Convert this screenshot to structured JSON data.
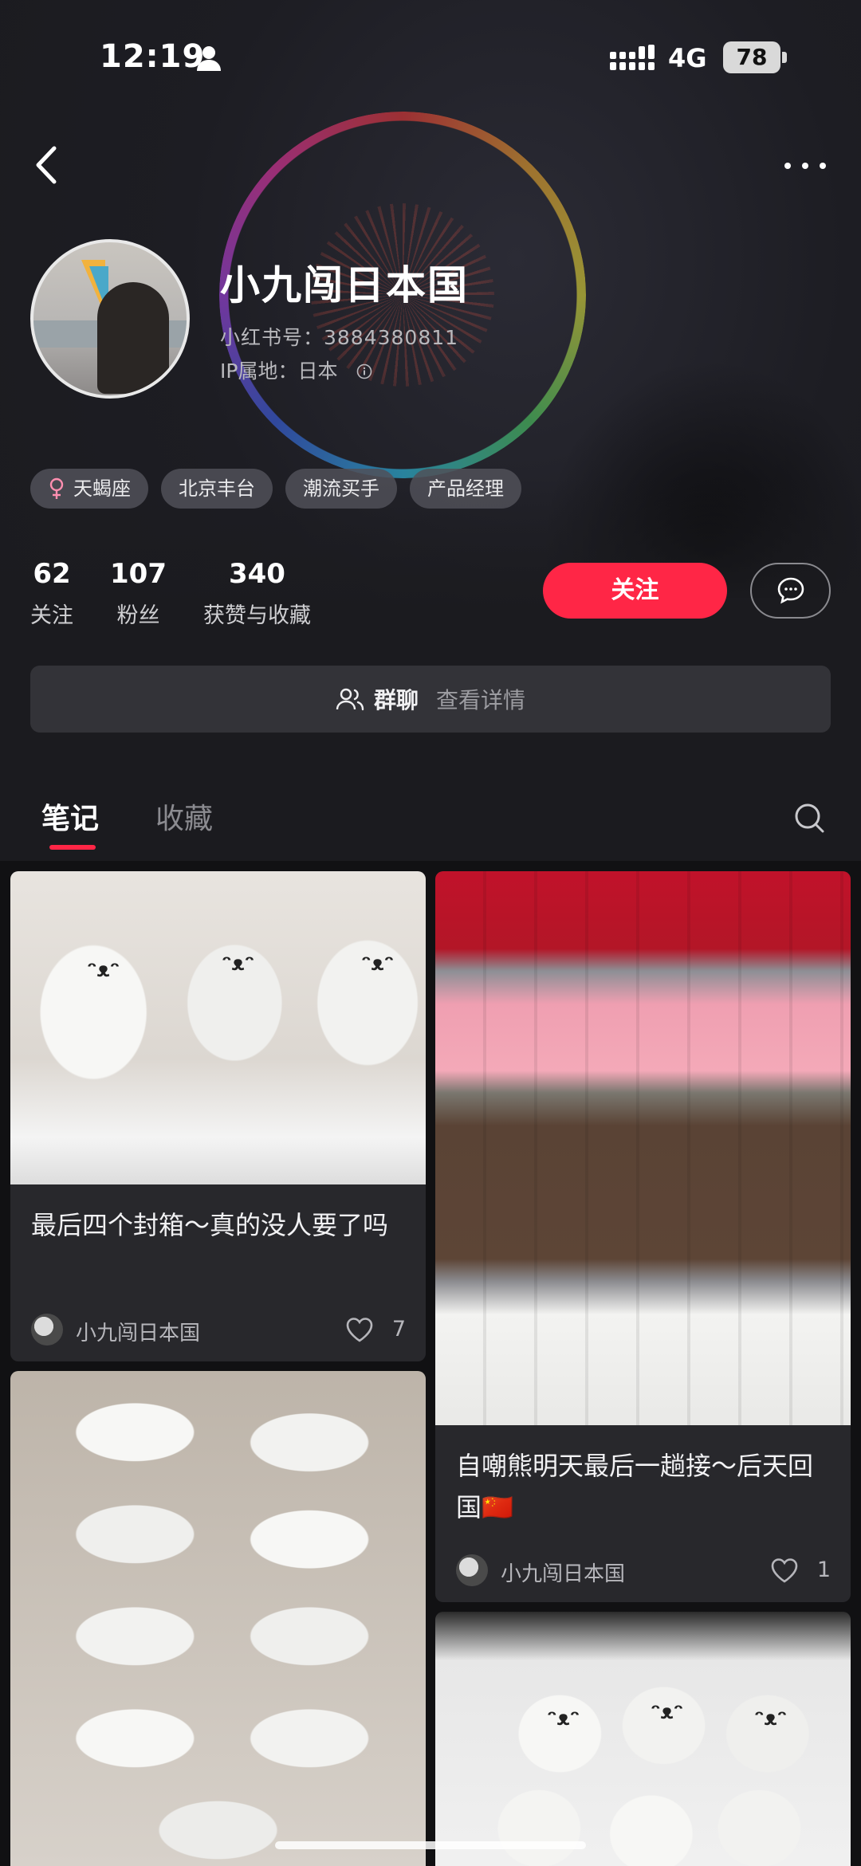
{
  "status_bar": {
    "time": "12:19",
    "network": "4G",
    "battery": "78"
  },
  "profile": {
    "name": "小九闯日本国",
    "account_id": "小红书号：3884380811",
    "ip_location": "IP属地：日本",
    "tags": [
      "天蝎座",
      "北京丰台",
      "潮流买手",
      "产品经理"
    ],
    "stats": [
      {
        "num": "62",
        "label": "关注"
      },
      {
        "num": "107",
        "label": "粉丝"
      },
      {
        "num": "340",
        "label": "获赞与收藏"
      }
    ],
    "follow_label": "关注",
    "group_chat_label": "群聊",
    "group_chat_detail": "查看详情"
  },
  "tabs": [
    {
      "label": "笔记",
      "active": true
    },
    {
      "label": "收藏",
      "active": false
    }
  ],
  "notes": [
    {
      "title": "最后四个封箱～真的没人要了吗",
      "author": "小九闯日本国",
      "likes": "7"
    },
    {
      "title": "自嘲熊明天最后一趟接～后天回国🇨🇳",
      "author": "小九闯日本国",
      "likes": "1"
    }
  ],
  "colors": {
    "accent": "#ff2646",
    "background": "#1b1b1f",
    "card": "#28282c"
  },
  "icons": [
    "person-icon",
    "signal-icon",
    "back-icon",
    "more-icon",
    "info-icon",
    "female-icon",
    "message-icon",
    "group-icon",
    "search-icon",
    "heart-icon"
  ]
}
